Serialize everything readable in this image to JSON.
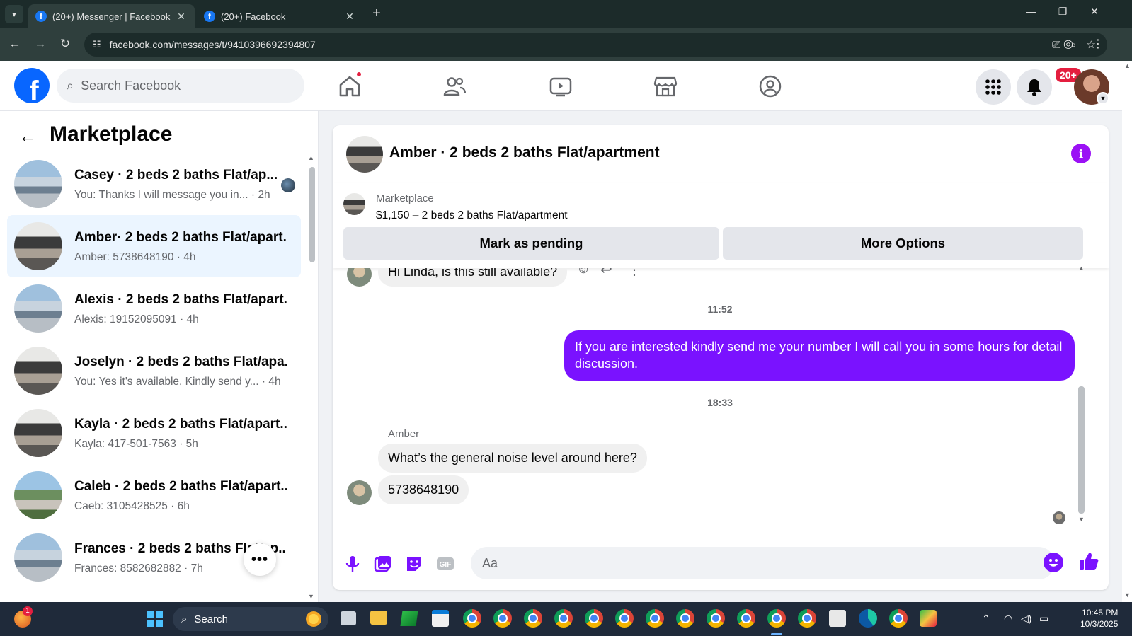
{
  "browser": {
    "tabs": [
      {
        "title": "(20+) Messenger | Facebook",
        "active": true
      },
      {
        "title": "(20+) Facebook",
        "active": false
      }
    ],
    "url": "facebook.com/messages/t/9410396692394807"
  },
  "header": {
    "logo": "f",
    "search_placeholder": "Search Facebook",
    "notification_badge": "20+"
  },
  "sidebar": {
    "title": "Marketplace",
    "conversations": [
      {
        "name": "Casey · 2 beds 2 baths Flat/ap...",
        "preview": "You: Thanks I will message you in... · 2h",
        "active": false
      },
      {
        "name": "Amber· 2 beds 2 baths Flat/apart...",
        "preview": "Amber: 5738648190 · 4h",
        "active": true
      },
      {
        "name": "Alexis · 2 beds 2 baths Flat/apart...",
        "preview": "Alexis: 19152095091 · 4h",
        "active": false
      },
      {
        "name": "Joselyn · 2 beds 2 baths Flat/apa...",
        "preview": "You: Yes it's available, Kindly send y...  · 4h",
        "active": false
      },
      {
        "name": "Kayla · 2 beds 2 baths Flat/apart...",
        "preview": "Kayla: 417-501-7563 · 5h",
        "active": false
      },
      {
        "name": "Caleb · 2 beds 2 baths Flat/apart...",
        "preview": "Caeb: 3105428525 · 6h",
        "active": false
      },
      {
        "name": "Frances · 2 beds 2 baths Flat/ap...",
        "preview": "Frances: 8582682882 · 7h",
        "active": false
      }
    ],
    "more_label": "•••"
  },
  "chat": {
    "title": "Amber · 2 beds 2 baths Flat/apartment",
    "marketplace_label": "Marketplace",
    "listing": "$1,150 – 2 beds 2 baths Flat/apartment",
    "mark_pending_label": "Mark as pending",
    "more_options_label": "More Options",
    "messages": {
      "first_in": "Hi Linda, is this still available?",
      "time_1": "11:52",
      "out_1": "If you are interested kindly send me your number I will call you in some hours for detail discussion.",
      "time_2": "18:33",
      "sender": "Amber",
      "in_2": "What’s the general noise level around here?",
      "in_3": "5738648190"
    },
    "composer_placeholder": "Aa"
  },
  "taskbar": {
    "search_placeholder": "Search",
    "notification_count": "1",
    "time": "10:45 PM",
    "date": "10/3/2025"
  },
  "colors": {
    "facebook_blue": "#0866ff",
    "messenger_purple": "#7a12ff",
    "badge_red": "#e41e3f",
    "active_conversation": "#ebf5ff"
  }
}
